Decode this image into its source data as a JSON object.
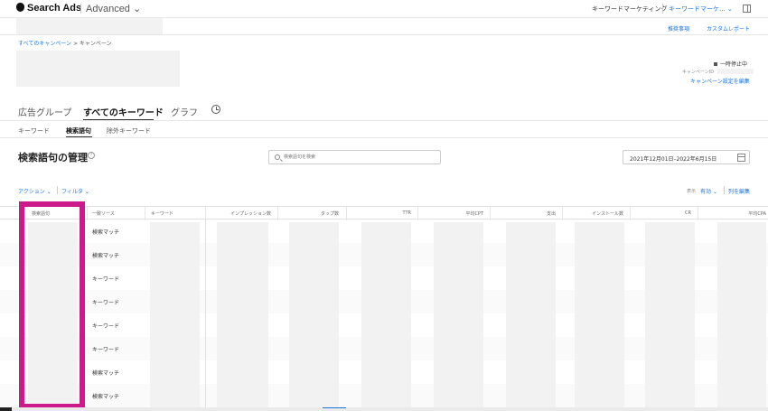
{
  "topbar": {
    "brand": "Search Ads",
    "product": "Advanced",
    "org_name": "キーワードマーケティング",
    "account_name": "キーワードマーケ...",
    "icons": [
      "apple-logo-icon",
      "chevron-down-icon",
      "panel-toggle-icon"
    ]
  },
  "subbar": {
    "recommendations": "推奨事項",
    "custom_reports": "カスタムレポート"
  },
  "breadcrumb": {
    "all_campaigns": "すべてのキャンペーン",
    "separator": ">",
    "current": "キャンペーン"
  },
  "campaign": {
    "status": "一時停止中",
    "id_label": "キャンペーンID",
    "edit_settings": "キャンペーン設定を編集"
  },
  "tabs": {
    "ad_groups": "広告グループ",
    "all_keywords": "すべてのキーワード",
    "graph": "グラフ",
    "active": "all_keywords"
  },
  "subtabs": {
    "keywords": "キーワード",
    "search_terms": "検索語句",
    "negative_keywords": "除外キーワード",
    "active": "search_terms"
  },
  "section": {
    "title": "検索語句の管理",
    "search_placeholder": "検索語句を検索",
    "date_range": "2021年12月01日–2022年6月15日"
  },
  "toolbar": {
    "action": "アクション",
    "filter": "フィルタ",
    "display_label": "表示",
    "display_value": "有効",
    "edit_columns": "列を編集"
  },
  "table": {
    "columns": {
      "search_term": "検索語句",
      "source": "一致ソース",
      "keyword": "キーワード",
      "impressions": "インプレッション数",
      "taps": "タップ数",
      "ttr": "TTR",
      "avg_cpt": "平均CPT",
      "spend": "支出",
      "installs": "インストール数",
      "cr": "CR",
      "avg_cpa": "平均CPA"
    },
    "rows": [
      {
        "source": "検索マッチ"
      },
      {
        "source": "検索マッチ"
      },
      {
        "source": "キーワード"
      },
      {
        "source": "キーワード"
      },
      {
        "source": "キーワード"
      },
      {
        "source": "キーワード"
      },
      {
        "source": "検索マッチ"
      },
      {
        "source": "検索マッチ"
      }
    ]
  },
  "colors": {
    "link": "#1a73d9",
    "highlight": "#cc1a8a",
    "placeholder": "#f2f2f2"
  }
}
